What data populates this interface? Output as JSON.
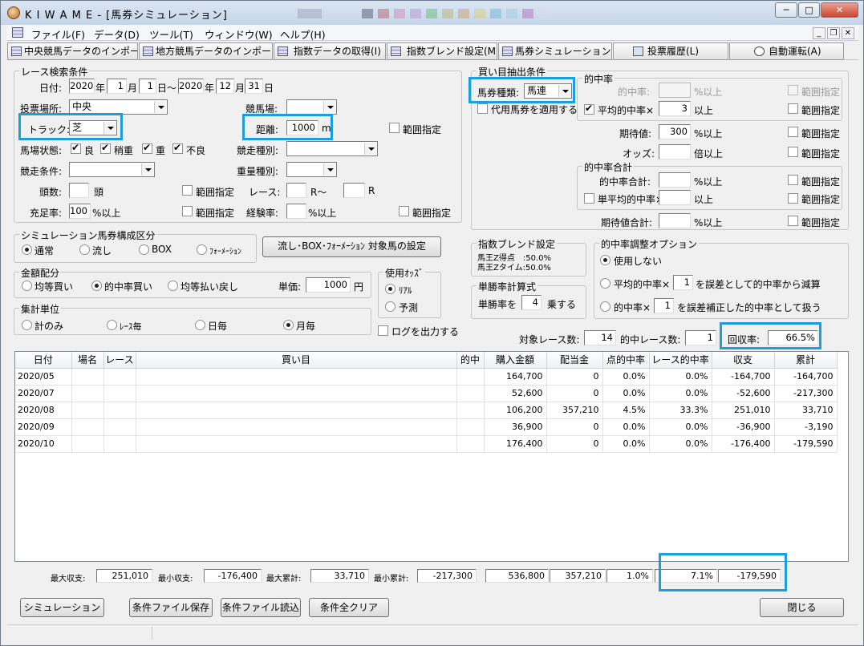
{
  "window": {
    "title": "K I W A M E - [馬券シミュレーション]",
    "min": "─",
    "max": "□",
    "close": "✕"
  },
  "menu": [
    "ファイル(F)",
    "データ(D)",
    "ツール(T)",
    "ウィンドウ(W)",
    "ヘルプ(H)"
  ],
  "mdi": {
    "min": "_",
    "restore": "❐",
    "close": "✕"
  },
  "toolbar": [
    "中央競馬データのインポート(J)",
    "地方競馬データのインポート(N)",
    "指数データの取得(I)",
    "指数ブレンド設定(M)",
    "馬券シミュレーション(B)",
    "投票履歴(L)",
    "自動運転(A)"
  ],
  "race": {
    "group": "レース検索条件",
    "date_label": "日付:",
    "from_year": "2020",
    "year_unit": "年",
    "from_month": "1",
    "month_unit": "月",
    "from_day": "1",
    "day_tilde": "日～",
    "to_year": "2020",
    "to_month": "12",
    "to_day": "31",
    "day_unit": "日",
    "venue_label": "投票場所:",
    "venue": "中央",
    "course_label": "競馬場:",
    "course": "",
    "track_label": "トラック:",
    "track": "芝",
    "distance_label": "距離:",
    "distance": "1000",
    "distance_unit": "m",
    "range": "範囲指定",
    "cond_label": "馬場状態:",
    "cond": [
      "良",
      "稍重",
      "重",
      "不良"
    ],
    "type_label": "競走種別:",
    "race_cond_label": "競走条件:",
    "weight_label": "重量種別:",
    "heads_label": "頭数:",
    "heads_unit": "頭",
    "race_label": "レース:",
    "r_from": "R～",
    "r_to": "R",
    "fill_label": "充足率:",
    "fill": "100",
    "fill_unit": "%以上",
    "exp_label": "経験率:",
    "exp_unit": "%以上"
  },
  "sim": {
    "group": "シミュレーション馬券構成区分",
    "opts": [
      "通常",
      "流し",
      "BOX",
      "ﾌｫｰﾒｰｼｮﾝ"
    ],
    "set_button": "流し･BOX･ﾌｫｰﾒｰｼｮﾝ 対象馬の設定"
  },
  "money": {
    "group": "金額配分",
    "opts": [
      "均等買い",
      "的中率買い",
      "均等払い戻し"
    ],
    "unit_label": "単価:",
    "unit_value": "1000",
    "unit_suffix": "円"
  },
  "agg": {
    "group": "集計単位",
    "opts": [
      "計のみ",
      "ﾚｰｽ毎",
      "日毎",
      "月毎"
    ]
  },
  "odds": {
    "group": "使用ｵｯｽﾞ",
    "opts": [
      "ﾘｱﾙ",
      "予測"
    ],
    "log": "ログを出力する"
  },
  "buy": {
    "group": "買い目抽出条件",
    "bet_label": "馬券種類:",
    "bet_type": "馬連",
    "alt": "代用馬券を適用する",
    "hit_group": "的中率",
    "hit_label": "的中率:",
    "hit_unit": "%以上",
    "avg_label": "平均的中率×",
    "avg_value": "3",
    "avg_unit": "以上",
    "ev_label": "期待値:",
    "ev_value": "300",
    "ev_unit": "%以上",
    "odds_label": "オッズ:",
    "odds_unit": "倍以上",
    "total_group": "的中率合計",
    "hit_sum_label": "的中率合計:",
    "hit_sum_unit": "%以上",
    "single_label": "単平均的中率×",
    "single_unit": "以上",
    "ev_sum_label": "期待値合計:",
    "ev_sum_unit": "%以上",
    "range": "範囲指定"
  },
  "blend": {
    "group": "指数ブレンド設定",
    "lines": [
      "馬王Z得点　:50.0%",
      "馬王Zタイム:50.0%"
    ]
  },
  "single": {
    "group": "単勝率計算式",
    "pre": "単勝率を",
    "value": "4",
    "post": "乗する"
  },
  "adjust": {
    "group": "的中率調整オプション",
    "opt1": "使用しない",
    "opt2a": "平均的中率×",
    "opt2v": "1",
    "opt2b": "を誤差として的中率から減算",
    "opt3a": "的中率×",
    "opt3v": "1",
    "opt3b": "を誤差補正した的中率として扱う"
  },
  "stats": {
    "target_label": "対象レース数:",
    "target": "14",
    "hit_label": "的中レース数:",
    "hit": "1",
    "rec_label": "回収率:",
    "rec": "66.5%"
  },
  "table": {
    "headers": [
      "日付",
      "場名",
      "レース",
      "買い目",
      "的中",
      "購入金額",
      "配当金",
      "点的中率",
      "レース的中率",
      "収支",
      "累計"
    ],
    "rows": [
      [
        "2020/05",
        "",
        "",
        "",
        "",
        "164,700",
        "0",
        "0.0%",
        "0.0%",
        "-164,700",
        "-164,700"
      ],
      [
        "2020/07",
        "",
        "",
        "",
        "",
        "52,600",
        "0",
        "0.0%",
        "0.0%",
        "-52,600",
        "-217,300"
      ],
      [
        "2020/08",
        "",
        "",
        "",
        "",
        "106,200",
        "357,210",
        "4.5%",
        "33.3%",
        "251,010",
        "33,710"
      ],
      [
        "2020/09",
        "",
        "",
        "",
        "",
        "36,900",
        "0",
        "0.0%",
        "0.0%",
        "-36,900",
        "-3,190"
      ],
      [
        "2020/10",
        "",
        "",
        "",
        "",
        "176,400",
        "0",
        "0.0%",
        "0.0%",
        "-176,400",
        "-179,590"
      ]
    ]
  },
  "summary": {
    "max_inc_label": "最大収支:",
    "max_inc": "251,010",
    "min_inc_label": "最小収支:",
    "min_inc": "-176,400",
    "max_cum_label": "最大累計:",
    "max_cum": "33,710",
    "min_cum_label": "最小累計:",
    "min_cum": "-217,300",
    "buy_total": "536,800",
    "pay_total": "357,210",
    "point_rate": "1.0%",
    "race_rate": "7.1%",
    "balance": "-179,590"
  },
  "buttons": {
    "simulate": "シミュレーション",
    "save": "条件ファイル保存",
    "load": "条件ファイル読込",
    "clear": "条件全クリア",
    "close": "閉じる"
  }
}
